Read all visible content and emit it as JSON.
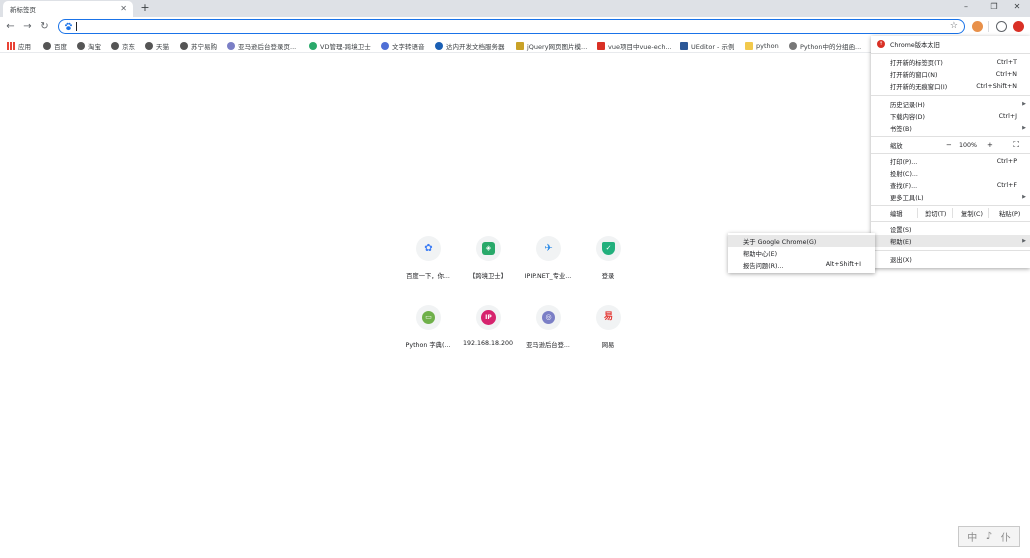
{
  "tab": {
    "title": "新标签页",
    "close": "✕",
    "new_tab": "+"
  },
  "window": {
    "minimize": "–",
    "maximize": "❐",
    "close": "✕"
  },
  "toolbar": {
    "back": "←",
    "forward": "→",
    "reload": "↻",
    "omnibox_value": "",
    "omnibox_placeholder": "",
    "star": "☆"
  },
  "colors": {
    "accent": "#1a73e8",
    "update": "#d93025",
    "menu_highlight": "#e8e8e8"
  },
  "bookmarks": [
    {
      "label": "应用",
      "icon": "apps-grid-icon",
      "color": "#e94235"
    },
    {
      "label": "百度",
      "icon": "globe-icon",
      "color": "#555555"
    },
    {
      "label": "淘宝",
      "icon": "globe-icon",
      "color": "#555555"
    },
    {
      "label": "京东",
      "icon": "globe-icon",
      "color": "#555555"
    },
    {
      "label": "天猫",
      "icon": "globe-icon",
      "color": "#555555"
    },
    {
      "label": "苏宁易购",
      "icon": "globe-icon",
      "color": "#555555"
    },
    {
      "label": "亚马逊后台登录页...",
      "icon": "amazon-icon",
      "color": "#7b7fc6"
    },
    {
      "label": "VD管理-跨境卫士",
      "icon": "shield-icon",
      "color": "#29a96a"
    },
    {
      "label": "文字转语音",
      "icon": "mic-icon",
      "color": "#4f6fd6"
    },
    {
      "label": "达内开发文档服务器",
      "icon": "tarena-icon",
      "color": "#1a5fb4"
    },
    {
      "label": "jQuery网页图片模...",
      "icon": "jquery-icon",
      "color": "#c9a227"
    },
    {
      "label": "vue项目中vue-ech...",
      "icon": "csdn-icon",
      "color": "#d93025"
    },
    {
      "label": "UEditor - 示例",
      "icon": "ueditor-icon",
      "color": "#2b5797"
    },
    {
      "label": "python",
      "icon": "folder-icon",
      "color": "#f2c94c"
    },
    {
      "label": "Python中的分组函...",
      "icon": "python-icon",
      "color": "#777777"
    }
  ],
  "shortcuts": [
    {
      "label": "百度一下，你...",
      "glyph": "✿",
      "color": "#3b7cf5",
      "icon": "baidu-paw-icon"
    },
    {
      "label": "【跨境卫士】",
      "glyph": "◈",
      "color": "#29a96a",
      "icon": "kuajing-shield-icon"
    },
    {
      "label": "IPIP.NET_专业...",
      "glyph": "✈",
      "color": "#2b8ae6",
      "icon": "ipip-icon"
    },
    {
      "label": "登录",
      "glyph": "✓",
      "color": "#22b07d",
      "icon": "login-shield-icon"
    },
    {
      "label": "Python 字典(...",
      "glyph": "▭",
      "color": "#6fb04a",
      "icon": "python-dict-icon"
    },
    {
      "label": "192.168.18.200",
      "glyph": "IP",
      "color": "#d6246e",
      "icon": "ip-icon"
    },
    {
      "label": "亚马逊后台登...",
      "glyph": "◎",
      "color": "#7b7fc6",
      "icon": "amazon-icon"
    },
    {
      "label": "网易",
      "glyph": "易",
      "color": "#e53935",
      "icon": "netease-icon"
    }
  ],
  "menu": {
    "update_label": "Chrome版本太旧",
    "new_tab": {
      "label": "打开新的标签页(T)",
      "shortcut": "Ctrl+T"
    },
    "new_window": {
      "label": "打开新的窗口(N)",
      "shortcut": "Ctrl+N"
    },
    "incognito": {
      "label": "打开新的无痕窗口(I)",
      "shortcut": "Ctrl+Shift+N"
    },
    "history": {
      "label": "历史记录(H)"
    },
    "downloads": {
      "label": "下载内容(D)",
      "shortcut": "Ctrl+J"
    },
    "bookmarks": {
      "label": "书签(B)"
    },
    "zoom": {
      "label": "缩放",
      "minus": "−",
      "value": "100%",
      "plus": "+",
      "fullscreen": "⛶"
    },
    "print": {
      "label": "打印(P)...",
      "shortcut": "Ctrl+P"
    },
    "cast": {
      "label": "投射(C)..."
    },
    "find": {
      "label": "查找(F)...",
      "shortcut": "Ctrl+F"
    },
    "more_tools": {
      "label": "更多工具(L)"
    },
    "edit": {
      "label": "编辑",
      "cut": "剪切(T)",
      "copy": "复制(C)",
      "paste": "粘贴(P)"
    },
    "settings": {
      "label": "设置(S)"
    },
    "help": {
      "label": "帮助(E)"
    },
    "exit": {
      "label": "退出(X)"
    },
    "arrow": "▶"
  },
  "help_submenu": {
    "about": {
      "label": "关于 Google Chrome(G)"
    },
    "help_center": {
      "label": "帮助中心(E)"
    },
    "report": {
      "label": "报告问题(R)...",
      "shortcut": "Alt+Shift+I"
    }
  },
  "watermark": {
    "chars": [
      "中",
      "♪",
      "仆"
    ]
  }
}
